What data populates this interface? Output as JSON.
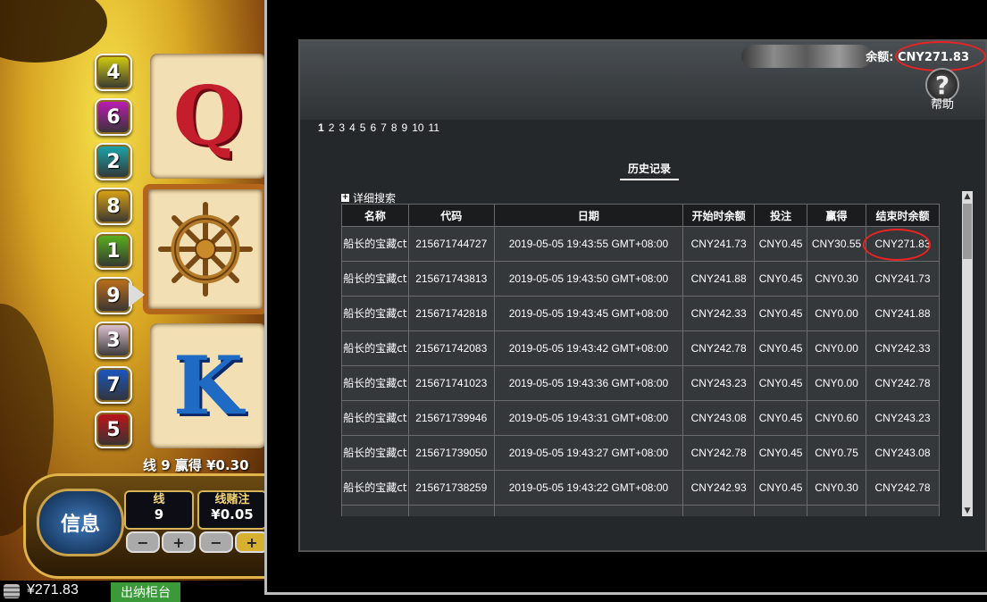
{
  "game": {
    "line_numbers": [
      {
        "num": "4",
        "color": "#d8d20e"
      },
      {
        "num": "6",
        "color": "#c21ab8"
      },
      {
        "num": "2",
        "color": "#1aa9b0"
      },
      {
        "num": "8",
        "color": "#e0a514"
      },
      {
        "num": "1",
        "color": "#5bb41c"
      },
      {
        "num": "9",
        "color": "#c0701a"
      },
      {
        "num": "3",
        "color": "#e4c8d8"
      },
      {
        "num": "7",
        "color": "#1a58c6"
      },
      {
        "num": "5",
        "color": "#c2141a"
      }
    ],
    "reel_symbols": [
      "Q",
      "ship-wheel",
      "K"
    ],
    "win_text": "线 9 赢得 ¥0.30",
    "info_label": "信息",
    "lines_label": "线",
    "lines_value": "9",
    "line_bet_label": "线赌注",
    "line_bet_value": "¥0.05",
    "minus": "−",
    "plus": "+"
  },
  "bottom": {
    "balance": "¥271.83",
    "cashier_label": "出纳柜台"
  },
  "history": {
    "balance_label": "余额: CNY271.83",
    "help_label": "帮助",
    "pages": [
      "1",
      "2",
      "3",
      "4",
      "5",
      "6",
      "7",
      "8",
      "9",
      "10",
      "11"
    ],
    "tab_label": "历史记录",
    "advanced_search": "详细搜索",
    "columns": [
      "名称",
      "代码",
      "日期",
      "开始时余额",
      "投注",
      "赢得",
      "结束时余额"
    ],
    "rows": [
      {
        "name": "船长的宝藏ct",
        "code": "215671744727",
        "date": "2019-05-05 19:43:55 GMT+08:00",
        "start": "CNY241.73",
        "bet": "CNY0.45",
        "win": "CNY30.55",
        "end": "CNY271.83"
      },
      {
        "name": "船长的宝藏ct",
        "code": "215671743813",
        "date": "2019-05-05 19:43:50 GMT+08:00",
        "start": "CNY241.88",
        "bet": "CNY0.45",
        "win": "CNY0.30",
        "end": "CNY241.73"
      },
      {
        "name": "船长的宝藏ct",
        "code": "215671742818",
        "date": "2019-05-05 19:43:45 GMT+08:00",
        "start": "CNY242.33",
        "bet": "CNY0.45",
        "win": "CNY0.00",
        "end": "CNY241.88"
      },
      {
        "name": "船长的宝藏ct",
        "code": "215671742083",
        "date": "2019-05-05 19:43:42 GMT+08:00",
        "start": "CNY242.78",
        "bet": "CNY0.45",
        "win": "CNY0.00",
        "end": "CNY242.33"
      },
      {
        "name": "船长的宝藏ct",
        "code": "215671741023",
        "date": "2019-05-05 19:43:36 GMT+08:00",
        "start": "CNY243.23",
        "bet": "CNY0.45",
        "win": "CNY0.00",
        "end": "CNY242.78"
      },
      {
        "name": "船长的宝藏ct",
        "code": "215671739946",
        "date": "2019-05-05 19:43:31 GMT+08:00",
        "start": "CNY243.08",
        "bet": "CNY0.45",
        "win": "CNY0.60",
        "end": "CNY243.23"
      },
      {
        "name": "船长的宝藏ct",
        "code": "215671739050",
        "date": "2019-05-05 19:43:27 GMT+08:00",
        "start": "CNY242.78",
        "bet": "CNY0.45",
        "win": "CNY0.75",
        "end": "CNY243.08"
      },
      {
        "name": "船长的宝藏ct",
        "code": "215671738259",
        "date": "2019-05-05 19:43:22 GMT+08:00",
        "start": "CNY242.93",
        "bet": "CNY0.45",
        "win": "CNY0.30",
        "end": "CNY242.78"
      },
      {
        "name": "船长的宝藏ct",
        "code": "",
        "date": "",
        "start": "",
        "bet": "",
        "win": "",
        "end": ""
      }
    ]
  }
}
